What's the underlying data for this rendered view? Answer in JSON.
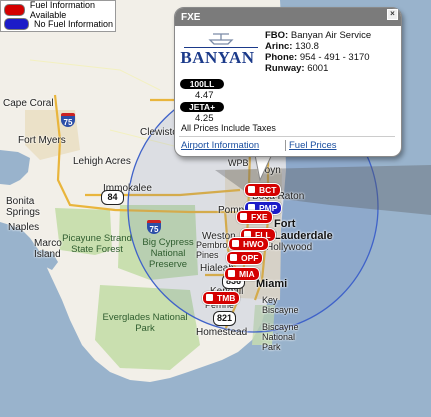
{
  "legend": {
    "available": "Fuel Information Available",
    "unavailable": "No Fuel Information",
    "available_color": "#d40000",
    "unavailable_color": "#1c1cc8"
  },
  "popup": {
    "code": "FXE",
    "logo_text": "BANYAN",
    "fbo_label": "FBO:",
    "fbo_value": "Banyan Air Service",
    "arinc_label": "Arinc:",
    "arinc_value": "130.8",
    "phone_label": "Phone:",
    "phone_value": "954 - 491 - 3170",
    "runway_label": "Runway:",
    "runway_value": "6001",
    "fuel": [
      {
        "type": "100LL",
        "price": "4.47"
      },
      {
        "type": "JETA+",
        "price": "4.25"
      }
    ],
    "tax_note": "All Prices Include Taxes",
    "link_airport": "Airport Information",
    "link_fuel": "Fuel Prices",
    "close_glyph": "×"
  },
  "markers": [
    {
      "code": "BCT",
      "color": "red"
    },
    {
      "code": "PMP",
      "color": "blue"
    },
    {
      "code": "FXE",
      "color": "red"
    },
    {
      "code": "FLL",
      "color": "red"
    },
    {
      "code": "HWO",
      "color": "red"
    },
    {
      "code": "OPF",
      "color": "red"
    },
    {
      "code": "MIA",
      "color": "red"
    },
    {
      "code": "TMB",
      "color": "red"
    }
  ],
  "places": {
    "cape_coral": "Cape Coral",
    "fort_myers": "Fort Myers",
    "lehigh_acres": "Lehigh Acres",
    "clewiston": "Clewiston",
    "immokalee": "Immokalee",
    "bonita_springs": "Bonita Springs",
    "naples": "Naples",
    "marco_island": "Marco Island",
    "picayune": "Picayune Strand State Forest",
    "big_cypress": "Big Cypress National Preserve",
    "everglades": "Everglades National Park",
    "boca_raton": "Boca Raton",
    "fort_lauderdale": "Fort Lauderdale",
    "hollywood": "Hollywood",
    "weston": "Weston",
    "pembroke_pines": "Pembroke Pines",
    "hialeah": "Hialeah",
    "miami": "Miami",
    "kendall": "Kendall",
    "key_biscayne": "Key Biscayne",
    "biscayne_natl": "Biscayne National Park",
    "perrine": "Perrine",
    "homestead": "Homestead",
    "pompano": "Pompano",
    "boyn": "Boyn",
    "wpb": "WPB"
  },
  "highways": [
    "75",
    "84",
    "75",
    "836",
    "821",
    "1"
  ],
  "colors": {
    "water": "#99b3cc",
    "land": "#f2efe8",
    "park": "#c9dfaf",
    "radius_circle": "#3f62c9"
  }
}
